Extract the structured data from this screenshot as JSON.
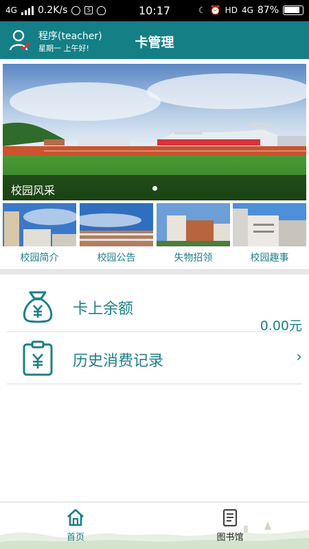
{
  "status": {
    "network": "4G",
    "speed": "0.2K/s",
    "time": "10:17",
    "hd": "HD",
    "net2": "4G",
    "battery": "87%"
  },
  "header": {
    "user_name": "程序(teacher)",
    "greeting": "星期一 上午好!",
    "title": "卡管理"
  },
  "banner": {
    "caption": "校园风采"
  },
  "tiles": [
    {
      "label": "校园简介"
    },
    {
      "label": "校园公告"
    },
    {
      "label": "失物招领"
    },
    {
      "label": "校园趣事"
    }
  ],
  "rows": {
    "balance_label": "卡上余额",
    "balance_value": "0.00元",
    "history_label": "历史消费记录"
  },
  "nav": {
    "home": "首页",
    "library": "图书馆"
  },
  "colors": {
    "accent": "#157f86",
    "text_accent": "#1d7f86"
  },
  "icons": {
    "avatar": "user-check-icon",
    "balance": "money-bag-icon",
    "history": "clipboard-yuan-icon",
    "home": "home-icon",
    "library": "book-icon"
  }
}
